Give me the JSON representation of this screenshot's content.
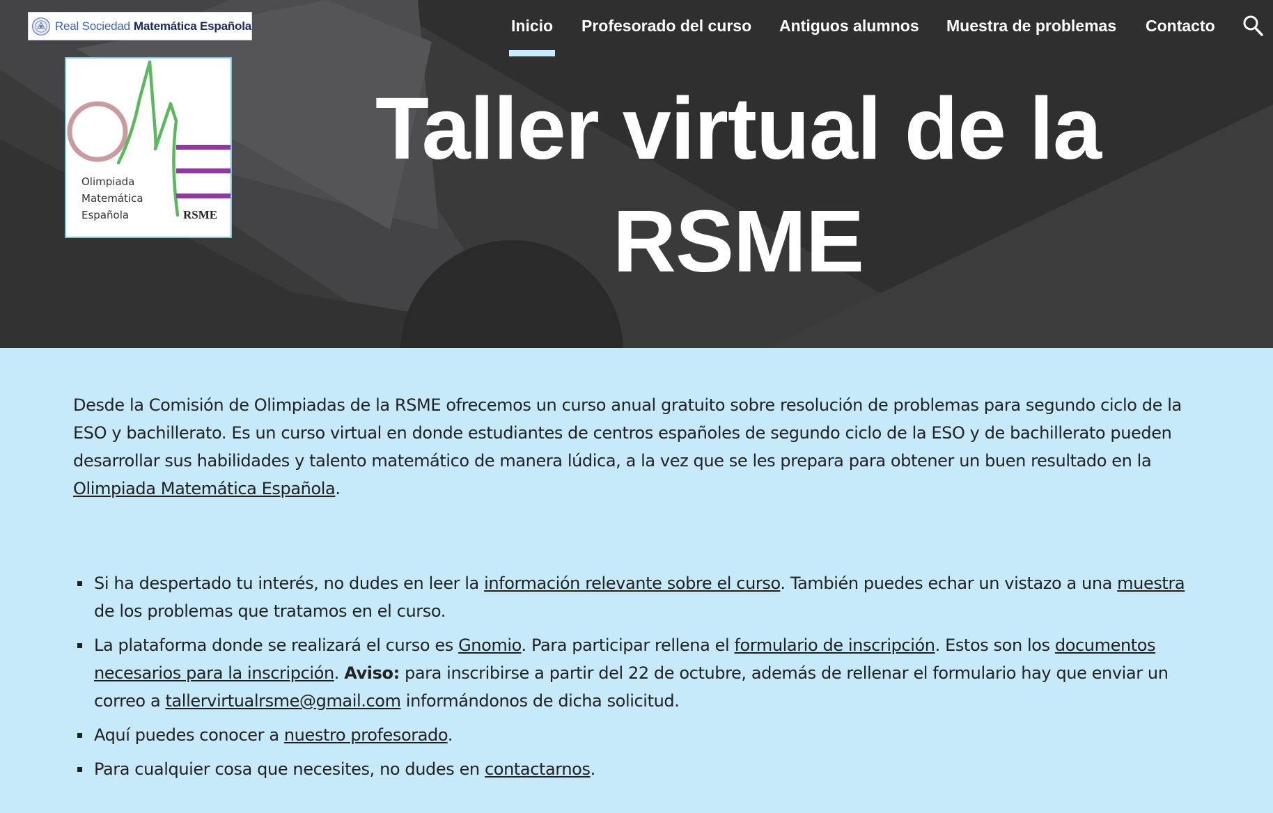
{
  "header": {
    "logo": {
      "text_light": "Real Sociedad",
      "text_bold": "Matemática Española"
    },
    "nav": [
      {
        "label": "Inicio",
        "active": true
      },
      {
        "label": "Profesorado del curso",
        "active": false
      },
      {
        "label": "Antiguos alumnos",
        "active": false
      },
      {
        "label": "Muestra de problemas",
        "active": false
      },
      {
        "label": "Contacto",
        "active": false
      }
    ],
    "search_icon": "search-icon"
  },
  "badge": {
    "line1": "Olimpiada",
    "line2": "Matemática",
    "line3": "Española",
    "tag": "RSME"
  },
  "hero": {
    "title_line1": "Taller virtual de la",
    "title_line2": "RSME"
  },
  "intro": {
    "text": "Desde la Comisión de Olimpiadas de la RSME ofrecemos un curso anual gratuito sobre resolución de problemas para segundo ciclo de la ESO y bachillerato. Es un curso virtual en donde estudiantes de centros españoles de segundo ciclo de la ESO y de bachillerato pueden desarrollar sus habilidades y talento matemático de manera lúdica, a la vez que se les prepara para obtener un buen resultado en la",
    "link": "Olimpiada Matemática Española",
    "end": "."
  },
  "bullets": {
    "b1": {
      "t1": "Si ha despertado tu interés, no dudes en leer la ",
      "link1": "información relevante sobre el curso",
      "t2": ". También puedes echar un vistazo a una ",
      "link2": "muestra",
      "t3": " de los problemas que tratamos en el curso."
    },
    "b2": {
      "t1": "La plataforma donde se realizará el curso es ",
      "link1": "Gnomio",
      "t2": ". Para participar rellena el ",
      "link2": "formulario de inscripción",
      "t3": ". Estos son los ",
      "link3": "documentos necesarios para la inscripción",
      "t4": ". ",
      "bold": "Aviso:",
      "t5": " para inscribirse a partir del 22 de octubre, además de rellenar el formulario hay que enviar un correo a ",
      "email": "tallervirtualrsme@gmail.com",
      "t6": " informándonos de dicha solicitud."
    },
    "b3": {
      "t1": "Aquí puedes conocer a ",
      "link1": "nuestro profesorado",
      "t2": "."
    },
    "b4": {
      "t1": "Para cualquier cosa que necesites, no dudes en ",
      "link1": "contactarnos",
      "t2": "."
    }
  },
  "colors": {
    "hero_bg": "#3a3a3b",
    "content_bg": "#c6eaf9",
    "nav_active_underline": "#c8ecfb",
    "badge_green": "#5cb85c",
    "badge_purple": "#8e3b9e",
    "badge_ring": "#c99a9f"
  }
}
